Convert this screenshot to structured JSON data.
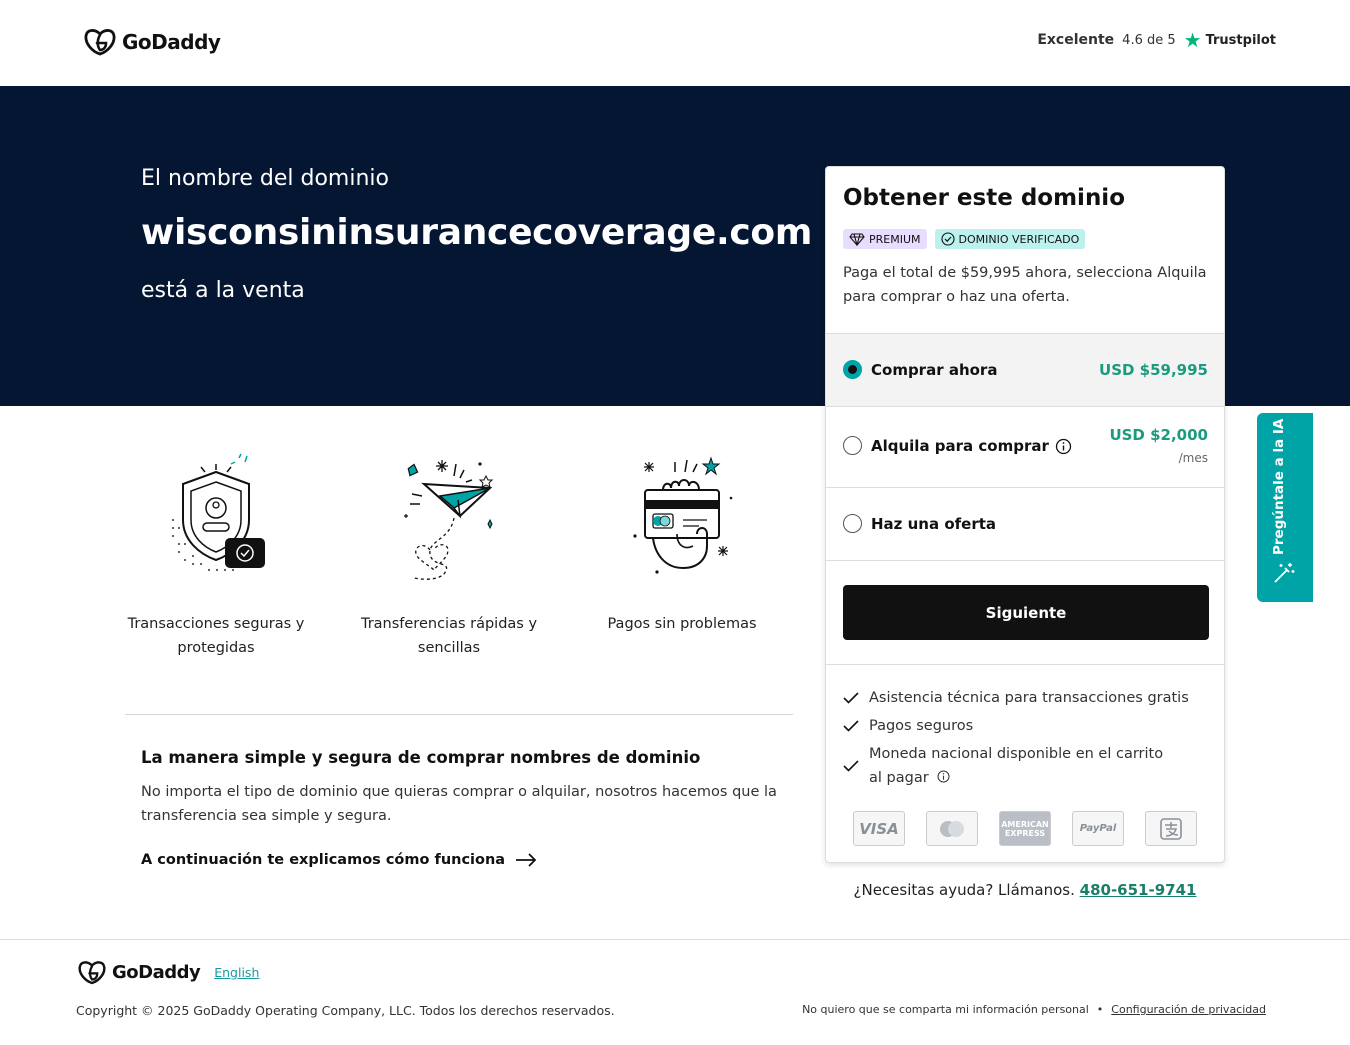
{
  "brand": {
    "name": "GoDaddy"
  },
  "trustpilot": {
    "rating_word": "Excelente",
    "score": "4.6 de 5",
    "brand": "Trustpilot"
  },
  "hero": {
    "line1": "El nombre del dominio",
    "domain": "wisconsininsurancecoverage.com",
    "line3": "está a la venta"
  },
  "features": [
    {
      "icon": "shield-icon",
      "caption": "Transacciones seguras y protegidas"
    },
    {
      "icon": "paper-plane-icon",
      "caption": "Transferencias rápidas y sencillas"
    },
    {
      "icon": "card-hand-icon",
      "caption": "Pagos sin problemas"
    }
  ],
  "info": {
    "title": "La manera simple y segura de comprar nombres de dominio",
    "body": "No importa el tipo de dominio que quieras comprar o alquilar, nosotros hacemos que la transferencia sea simple y segura.",
    "link": "A continuación te explicamos cómo funciona"
  },
  "card": {
    "title": "Obtener este dominio",
    "badge_premium": "PREMIUM",
    "badge_verified": "DOMINIO VERIFICADO",
    "description": "Paga el total de $59,995 ahora, selecciona Alquila para comprar o haz una oferta.",
    "options": [
      {
        "label": "Comprar ahora",
        "price": "USD $59,995",
        "selected": true
      },
      {
        "label": "Alquila para comprar",
        "price": "USD $2,000",
        "sub": "/mes",
        "selected": false
      },
      {
        "label": "Haz una oferta",
        "selected": false
      }
    ],
    "button": "Siguiente",
    "checks": [
      "Asistencia técnica para transacciones gratis",
      "Pagos seguros",
      "Moneda nacional disponible en el carrito al pagar"
    ],
    "payments": [
      "VISA",
      "Mastercard",
      "AMERICAN EXPRESS",
      "PayPal",
      "Alipay"
    ]
  },
  "help": {
    "text": "¿Necesitas ayuda? Llámanos.",
    "phone": "480-651-9741"
  },
  "ai_tab": {
    "label": "Pregúntale a la IA"
  },
  "footer": {
    "language": "English",
    "copyright": "Copyright © 2025 GoDaddy Operating Company, LLC. Todos los derechos reservados.",
    "no_share": "No quiero que se comparta mi información personal",
    "privacy": "Configuración de privacidad"
  },
  "colors": {
    "hero_bg": "#051632",
    "accent": "#00a4a6",
    "price_green": "#1a9a7e",
    "trustpilot": "#00b67a"
  }
}
